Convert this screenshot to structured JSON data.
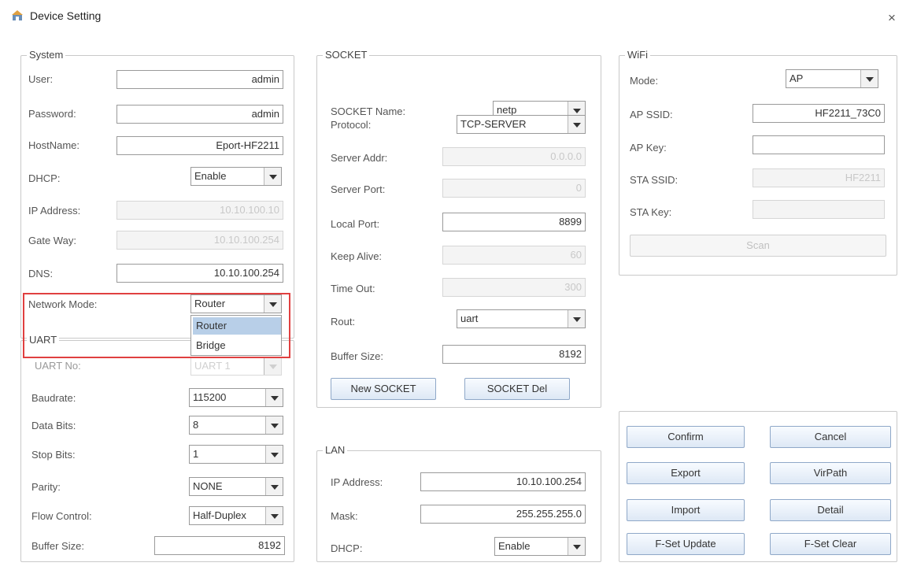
{
  "window": {
    "title": "Device Setting",
    "close_glyph": "×"
  },
  "system": {
    "label": "System",
    "user_label": "User:",
    "user_value": "admin",
    "password_label": "Password:",
    "password_value": "admin",
    "hostname_label": "HostName:",
    "hostname_value": "Eport-HF2211",
    "dhcp_label": "DHCP:",
    "dhcp_value": "Enable",
    "ip_label": "IP Address:",
    "ip_value": "10.10.100.10",
    "gateway_label": "Gate Way:",
    "gateway_value": "10.10.100.254",
    "dns_label": "DNS:",
    "dns_value": "10.10.100.254",
    "network_mode_label": "Network Mode:",
    "network_mode_value": "Router",
    "network_mode_options": [
      "Router",
      "Bridge"
    ]
  },
  "uart": {
    "label": "UART",
    "uart_no_label": "UART No:",
    "uart_no_value": "UART 1",
    "baudrate_label": "Baudrate:",
    "baudrate_value": "115200",
    "databits_label": "Data Bits:",
    "databits_value": "8",
    "stopbits_label": "Stop Bits:",
    "stopbits_value": "1",
    "parity_label": "Parity:",
    "parity_value": "NONE",
    "flow_label": "Flow Control:",
    "flow_value": "Half-Duplex",
    "buffer_label": "Buffer Size:",
    "buffer_value": "8192"
  },
  "socket": {
    "label": "SOCKET",
    "name_label": "SOCKET Name:",
    "name_value": "netp",
    "protocol_label": "Protocol:",
    "protocol_value": "TCP-SERVER",
    "server_addr_label": "Server Addr:",
    "server_addr_value": "0.0.0.0",
    "server_port_label": "Server Port:",
    "server_port_value": "0",
    "local_port_label": "Local Port:",
    "local_port_value": "8899",
    "keep_alive_label": "Keep Alive:",
    "keep_alive_value": "60",
    "timeout_label": "Time Out:",
    "timeout_value": "300",
    "rout_label": "Rout:",
    "rout_value": "uart",
    "buffer_label": "Buffer Size:",
    "buffer_value": "8192",
    "new_button": "New SOCKET",
    "del_button": "SOCKET Del"
  },
  "lan": {
    "label": "LAN",
    "ip_label": "IP Address:",
    "ip_value": "10.10.100.254",
    "mask_label": "Mask:",
    "mask_value": "255.255.255.0",
    "dhcp_label": "DHCP:",
    "dhcp_value": "Enable"
  },
  "wifi": {
    "label": "WiFi",
    "mode_label": "Mode:",
    "mode_value": "AP",
    "ap_ssid_label": "AP SSID:",
    "ap_ssid_value": "HF2211_73C0",
    "ap_key_label": "AP Key:",
    "ap_key_value": "",
    "sta_ssid_label": "STA SSID:",
    "sta_ssid_value": "HF2211",
    "sta_key_label": "STA Key:",
    "sta_key_value": "",
    "scan_button": "Scan"
  },
  "actions": {
    "confirm": "Confirm",
    "cancel": "Cancel",
    "export": "Export",
    "virpath": "VirPath",
    "import": "Import",
    "detail": "Detail",
    "fset_update": "F-Set Update",
    "fset_clear": "F-Set Clear"
  }
}
